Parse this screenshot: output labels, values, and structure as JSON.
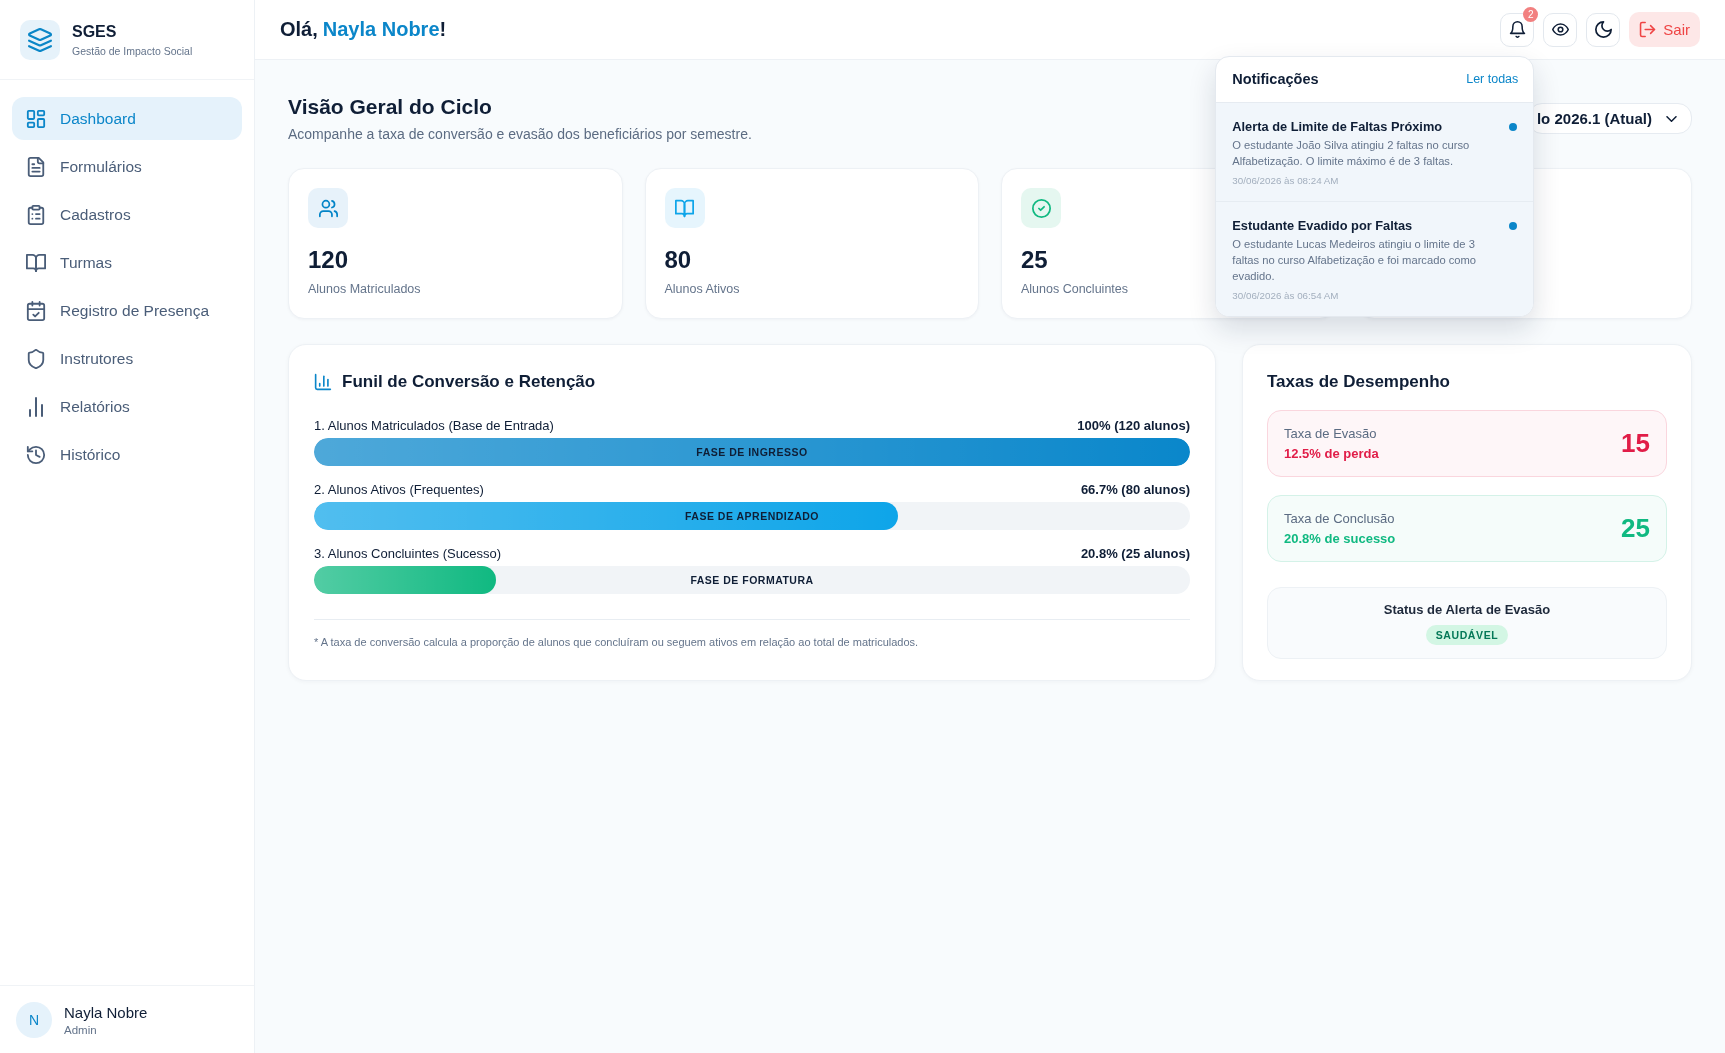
{
  "sidebar": {
    "brand": {
      "name": "SGES",
      "tagline": "Gestão de Impacto Social"
    },
    "items": [
      {
        "label": "Dashboard",
        "selected": true
      },
      {
        "label": "Formulários",
        "selected": false
      },
      {
        "label": "Cadastros",
        "selected": false
      },
      {
        "label": "Turmas",
        "selected": false
      },
      {
        "label": "Registro de Presença",
        "selected": false
      },
      {
        "label": "Instrutores",
        "selected": false
      },
      {
        "label": "Relatórios",
        "selected": false
      },
      {
        "label": "Histórico",
        "selected": false
      }
    ],
    "user": {
      "initial": "N",
      "name": "Nayla Nobre",
      "role": "Admin"
    }
  },
  "header": {
    "greeting": "Olá,",
    "user_name": "Nayla Nobre",
    "greeting_end": "!",
    "notification_count": "2",
    "logout_label": "Sair"
  },
  "notifications": {
    "title": "Notificações",
    "mark_all": "Ler todas",
    "items": [
      {
        "title": "Alerta de Limite de Faltas Próximo",
        "message": "O estudante João Silva atingiu 2 faltas no curso Alfabetização. O limite máximo é de 3 faltas.",
        "time": "30/06/2026 às 08:24 AM",
        "unread": true
      },
      {
        "title": "Estudante Evadido por Faltas",
        "message": "O estudante Lucas Medeiros atingiu o limite de 3 faltas no curso Alfabetização e foi marcado como evadido.",
        "time": "30/06/2026 às 06:54 AM",
        "unread": true
      }
    ]
  },
  "page": {
    "title": "Visão Geral do Ciclo",
    "subtitle": "Acompanhe a taxa de conversão e evasão dos beneficiários por semestre.",
    "cycle_select": "lo 2026.1 (Atual)"
  },
  "stats": [
    {
      "value": "120",
      "label": "Alunos Matriculados"
    },
    {
      "value": "80",
      "label": "Alunos Ativos"
    },
    {
      "value": "25",
      "label": "Alunos Concluintes"
    }
  ],
  "funnel": {
    "title": "Funil de Conversão e Retenção",
    "stages": [
      {
        "label": "1. Alunos Matriculados (Base de Entrada)",
        "reading": "100% (120 alunos)",
        "phase": "FASE DE INGRESSO",
        "level": 1,
        "color": "#0a87cb"
      },
      {
        "label": "2. Alunos Ativos (Frequentes)",
        "reading": "66.7% (80 alunos)",
        "phase": "FASE DE APRENDIZADO",
        "level": 0.667,
        "color": "#0ea5e9"
      },
      {
        "label": "3. Alunos Concluintes (Sucesso)",
        "reading": "20.8% (25 alunos)",
        "phase": "FASE DE FORMATURA",
        "level": 0.208,
        "color": "#10b981"
      }
    ],
    "footnote": "* A taxa de conversão calcula a proporção de alunos que concluíram ou seguem ativos em relação ao total de matriculados."
  },
  "performance": {
    "title": "Taxas de Desempenho",
    "rates": [
      {
        "label": "Taxa de Evasão",
        "detail": "12.5% de perda",
        "value": "15",
        "color": "#e11d48"
      },
      {
        "label": "Taxa de Conclusão",
        "detail": "20.8% de sucesso",
        "value": "25",
        "color": "#10b981"
      }
    ],
    "alert": {
      "title": "Status de Alerta de Evasão",
      "status": "SAUDÁVEL"
    }
  }
}
